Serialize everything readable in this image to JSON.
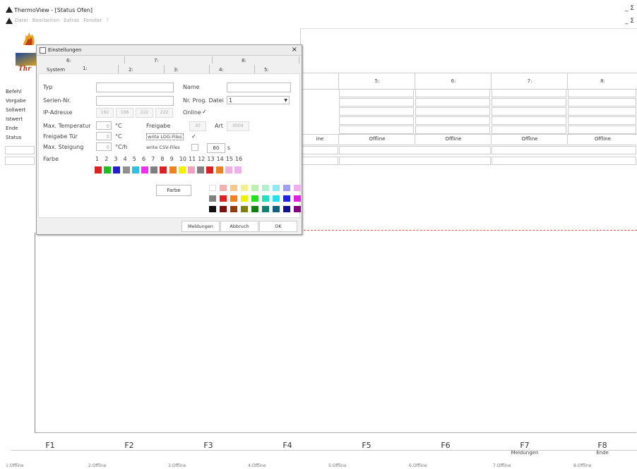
{
  "app": {
    "title": "ThermoView - [Status Ofen]",
    "menu": [
      "Datei",
      "Bearbeiten",
      "Extras",
      "Fenster",
      "?"
    ],
    "min_restore_top": "_ Ʃ",
    "min_restore_menu": "_ Ʃ"
  },
  "left_labels": [
    "Befehl",
    "Vorgabe",
    "Sollwert",
    "Istwert",
    "Ende",
    "Status"
  ],
  "status_columns": [
    "5:",
    "6:",
    "7:",
    "8:"
  ],
  "status_values": [
    "ine",
    "Offline",
    "Offline",
    "Offline",
    "Offline"
  ],
  "fkeys": [
    {
      "key": "F1",
      "sub": ""
    },
    {
      "key": "F2",
      "sub": ""
    },
    {
      "key": "F3",
      "sub": ""
    },
    {
      "key": "F4",
      "sub": ""
    },
    {
      "key": "F5",
      "sub": ""
    },
    {
      "key": "F6",
      "sub": ""
    },
    {
      "key": "F7",
      "sub": "Meldungen"
    },
    {
      "key": "F8",
      "sub": "Ende"
    }
  ],
  "statusbar": [
    "1:Offline",
    "2:Offline",
    "3:Offline",
    "4:Offline",
    "5:Offline",
    "6:Offline",
    "7:Offline",
    "8:Offline"
  ],
  "dialog": {
    "title": "Einstellungen",
    "tabs_row1": [
      "6:",
      "7:",
      "8:"
    ],
    "tabs_row2": [
      "System",
      "1:",
      "2:",
      "3:",
      "4:",
      "5:"
    ],
    "labels": {
      "typ": "Typ",
      "name": "Name",
      "serien": "Serien-Nr.",
      "nrprog": "Nr. Prog. Datei",
      "ip": "IP-Adresse",
      "online": "Online",
      "maxtemp": "Max. Temperatur",
      "freigabe": "Freigabe",
      "art": "Art",
      "freigabe_tuer": "Freigabe Tür",
      "log": "write LOG-Files",
      "max_steig": "Max. Steigung",
      "csv": "write CSV-Files",
      "farbe": "Farbe",
      "farbe_btn": "Farbe"
    },
    "values": {
      "typ": "",
      "name": "",
      "serien": "",
      "nrprog": "1",
      "ip": [
        "192",
        "168",
        "222",
        "222"
      ],
      "maxtemp": "0",
      "unit_c": "°C",
      "freigabe": "30",
      "art": "0004",
      "tuer": "0",
      "tuer_unit": "°C",
      "steig": "0",
      "steig_unit": "°C/h",
      "csv_interval": "60",
      "csv_unit": "s",
      "online_check": "✓",
      "log_check": "✓"
    },
    "color_numbers": [
      "1",
      "2",
      "3",
      "4",
      "5",
      "6",
      "7",
      "8",
      "9",
      "10",
      "11",
      "12",
      "13",
      "14",
      "15",
      "16"
    ],
    "swatches": [
      "#e02020",
      "#20c020",
      "#2020d0",
      "#909090",
      "#30c0e0",
      "#f030f0",
      "#808080",
      "#e02020",
      "#f08020",
      "#f0f000",
      "#f0a0c0",
      "#808080",
      "#e02020",
      "#f08020",
      "#f0b0e0",
      "#f0b0f0"
    ],
    "palette": [
      [
        "#ffffff",
        "#f4b0b0",
        "#f4c890",
        "#f4f090",
        "#c0f0b0",
        "#b0f0d0",
        "#90e8f0",
        "#a0a0f0",
        "#f0b0f0"
      ],
      [
        "#808080",
        "#e02020",
        "#f08020",
        "#f0f000",
        "#20e020",
        "#20e0c0",
        "#20e0f0",
        "#2020f0",
        "#e020e0"
      ],
      [
        "#101010",
        "#801010",
        "#904010",
        "#808010",
        "#108010",
        "#108070",
        "#106080",
        "#101090",
        "#800080"
      ]
    ],
    "buttons": [
      "Meldungen",
      "Abbruch",
      "OK"
    ]
  }
}
